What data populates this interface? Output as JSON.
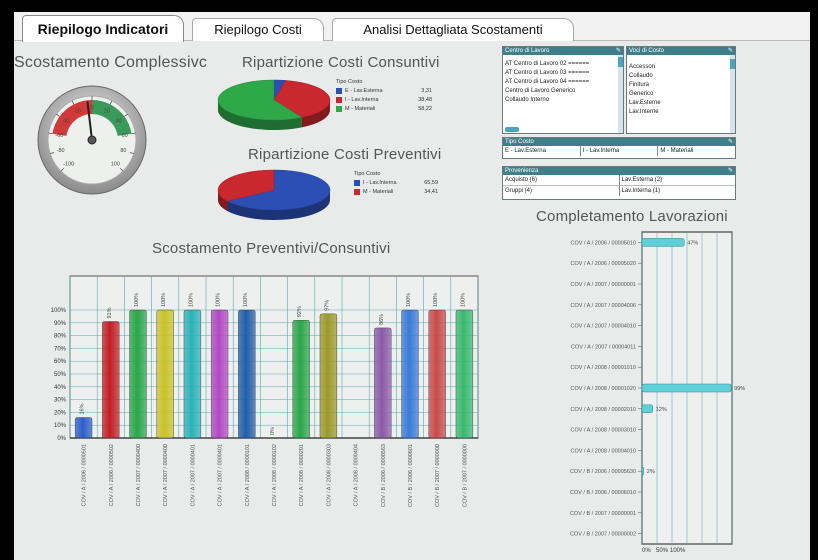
{
  "tabs": [
    {
      "label": "Riepilogo Indicatori",
      "active": true
    },
    {
      "label": "Riepilogo Costi",
      "active": false
    },
    {
      "label": "Analisi Dettagliata Scostamenti",
      "active": false
    }
  ],
  "gauge": {
    "title": "Scostamento Complessivc",
    "ticks": [
      "-100",
      "-80",
      "-60",
      "-40",
      "-20",
      "0",
      "20",
      "40",
      "60",
      "80",
      "100"
    ],
    "value": -5
  },
  "pie_consuntivi": {
    "title": "Ripartizione Costi Consuntivi",
    "legend_title": "Tipo Costo",
    "items": [
      {
        "label": "E - Lav.Esterna",
        "value": "3,31",
        "color": "#2b4fb5"
      },
      {
        "label": "I - Lav.Interna",
        "value": "38,48",
        "color": "#c8282e"
      },
      {
        "label": "M - Materiali",
        "value": "58,22",
        "color": "#2fa84a"
      }
    ]
  },
  "pie_preventivi": {
    "title": "Ripartizione Costi Preventivi",
    "legend_title": "Tipo Costo",
    "items": [
      {
        "label": "I - Lav.Interna",
        "value": "65,59",
        "color": "#2b4fb5"
      },
      {
        "label": "M - Materiali",
        "value": "34,41",
        "color": "#c8282e"
      }
    ]
  },
  "filters": {
    "centro": {
      "title": "Centro di Lavoro",
      "items": [
        "AT Centro di Lavoro 02 ======",
        "AT Centro di Lavoro 03 ======",
        "AT Centro di Lavoro 04 ======",
        "Centro di Lavoro Generico",
        "Collaudo Interno"
      ]
    },
    "voci": {
      "title": "Voci di Costo",
      "items": [
        "Accessori",
        "Collaudo",
        "Finitura",
        "Generico",
        "Lav.Esterne",
        "Lav.Interne"
      ]
    },
    "tipo": {
      "title": "Tipo Costo",
      "items": [
        "E - Lav.Esterna",
        "I - Lav.Interna",
        "M - Materiali"
      ]
    },
    "provenienza": {
      "title": "Provenienza",
      "items": [
        "Acquisto (6)",
        "Lav.Esterna (2)",
        "Gruppi (4)",
        "Lav.Interna (1)"
      ]
    }
  },
  "chart_data": [
    {
      "type": "bar",
      "title": "Scostamento Preventivi/Consuntivi",
      "categories": [
        "COV / A / 2006 / 0000501",
        "COV / A / 2006 / 0000502",
        "COV / A / 2007 / 0000400",
        "COV / A / 2007 / 0000400",
        "COV / A / 2007 / 0000401",
        "COV / A / 2007 / 0000401",
        "COV / A / 2008 / 0000101",
        "COV / A / 2008 / 0000102",
        "COV / A / 2008 / 0000201",
        "COV / A / 2008 / 0000303",
        "COV / A / 2008 / 0000404",
        "COV / B / 2006 / 0000563",
        "COV / B / 2006 / 0000601",
        "COV / B / 2007 / 0000000",
        "COV / B / 2007 / 0000000"
      ],
      "values": [
        16,
        91,
        100,
        100,
        100,
        100,
        100,
        0,
        92,
        97,
        0,
        86,
        100,
        100,
        100
      ],
      "labels": [
        "16%",
        "91%",
        "100%",
        "100%",
        "100%",
        "100%",
        "100%",
        "0%",
        "92%",
        "97%",
        "",
        "86%",
        "100%",
        "100%",
        "100%"
      ],
      "colors": [
        "#2b5fc8",
        "#c21e24",
        "#2aa64a",
        "#c9c22a",
        "#2ab3b8",
        "#b04ac2",
        "#1f5ea8",
        "#c21e24",
        "#2aa64a",
        "#9c9a2a",
        "#2ab3b8",
        "#8a5aa8",
        "#3a7ad8",
        "#c84a4a",
        "#3ab870"
      ],
      "y_ticks": [
        "0%",
        "10%",
        "20%",
        "30%",
        "40%",
        "50%",
        "60%",
        "70%",
        "80%",
        "90%",
        "100%"
      ],
      "ylim": [
        0,
        100
      ]
    },
    {
      "type": "bar",
      "orientation": "horizontal",
      "title": "Completamento Lavorazioni",
      "categories": [
        "COV / A / 2006 / 00005010",
        "COV / A / 2006 / 00005020",
        "COV / A / 2007 / 00000001",
        "COV / A / 2007 / 00004006",
        "COV / A / 2007 / 00004010",
        "COV / A / 2007 / 00004011",
        "COV / A / 2008 / 00001010",
        "COV / A / 2008 / 00001020",
        "COV / A / 2008 / 00002010",
        "COV / A / 2008 / 00003010",
        "COV / A / 2008 / 00004010",
        "COV / B / 2006 / 00005630",
        "COV / B / 2006 / 00006010",
        "COV / B / 2007 / 00000001",
        "COV / B / 2007 / 00000002"
      ],
      "values": [
        47,
        null,
        null,
        null,
        null,
        null,
        null,
        99,
        12,
        null,
        null,
        2,
        null,
        null,
        null
      ],
      "labels": [
        "47%",
        "",
        "",
        "",
        "",
        "",
        "",
        "99%",
        "12%",
        "",
        "",
        "2%",
        "",
        "",
        ""
      ],
      "x_ticks": [
        "0%",
        "50%",
        "100%"
      ],
      "xlim": [
        0,
        100
      ]
    }
  ]
}
